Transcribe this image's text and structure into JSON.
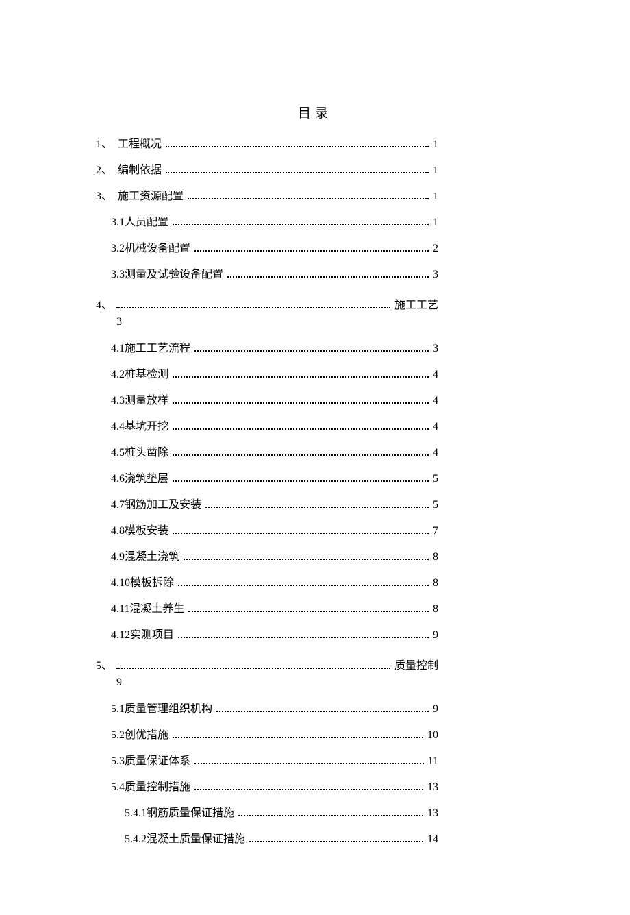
{
  "title": "目录",
  "toc": [
    {
      "num": "1、",
      "label": "工程概况",
      "page": "1",
      "level": 0
    },
    {
      "num": "2、",
      "label": "编制依据",
      "page": "1",
      "level": 0
    },
    {
      "num": "3、",
      "label": "施工资源配置",
      "page": "1",
      "level": 0
    },
    {
      "num": "",
      "label": "3.1人员配置",
      "page": "1",
      "level": 1
    },
    {
      "num": "",
      "label": "3.2机械设备配置",
      "page": "2",
      "level": 1
    },
    {
      "num": "",
      "label": "3.3测量及试验设备配置",
      "page": "3",
      "level": 1
    },
    {
      "num": "4、",
      "label": "施工工艺",
      "page": "3",
      "level": 0,
      "special": true
    },
    {
      "num": "",
      "label": "4.1施工工艺流程",
      "page": "3",
      "level": 1
    },
    {
      "num": "",
      "label": "4.2桩基检测",
      "page": "4",
      "level": 1
    },
    {
      "num": "",
      "label": "4.3测量放样",
      "page": "4",
      "level": 1
    },
    {
      "num": "",
      "label": "4.4基坑开挖",
      "page": "4",
      "level": 1
    },
    {
      "num": "",
      "label": "4.5桩头凿除",
      "page": "4",
      "level": 1
    },
    {
      "num": "",
      "label": "4.6浇筑垫层",
      "page": "5",
      "level": 1
    },
    {
      "num": "",
      "label": "4.7钢筋加工及安装",
      "page": "5",
      "level": 1
    },
    {
      "num": "",
      "label": "4.8模板安装",
      "page": "7",
      "level": 1
    },
    {
      "num": "",
      "label": "4.9混凝土浇筑",
      "page": "8",
      "level": 1
    },
    {
      "num": "",
      "label": "4.10模板拆除",
      "page": "8",
      "level": 1
    },
    {
      "num": "",
      "label": "4.11混凝土养生",
      "page": "8",
      "level": 1
    },
    {
      "num": "",
      "label": "4.12实测项目",
      "page": "9",
      "level": 1
    },
    {
      "num": "5、",
      "label": "质量控制",
      "page": "9",
      "level": 0,
      "special": true
    },
    {
      "num": "",
      "label": "5.1质量管理组织机构",
      "page": "9",
      "level": 1
    },
    {
      "num": "",
      "label": "5.2创优措施",
      "page": "10",
      "level": 1
    },
    {
      "num": "",
      "label": "5.3质量保证体系",
      "page": "11",
      "level": 1
    },
    {
      "num": "",
      "label": "5.4质量控制措施",
      "page": "13",
      "level": 1
    },
    {
      "num": "",
      "label": "5.4.1钢筋质量保证措施",
      "page": "13",
      "level": 2
    },
    {
      "num": "",
      "label": "5.4.2混凝土质量保证措施",
      "page": "14",
      "level": 2
    }
  ]
}
